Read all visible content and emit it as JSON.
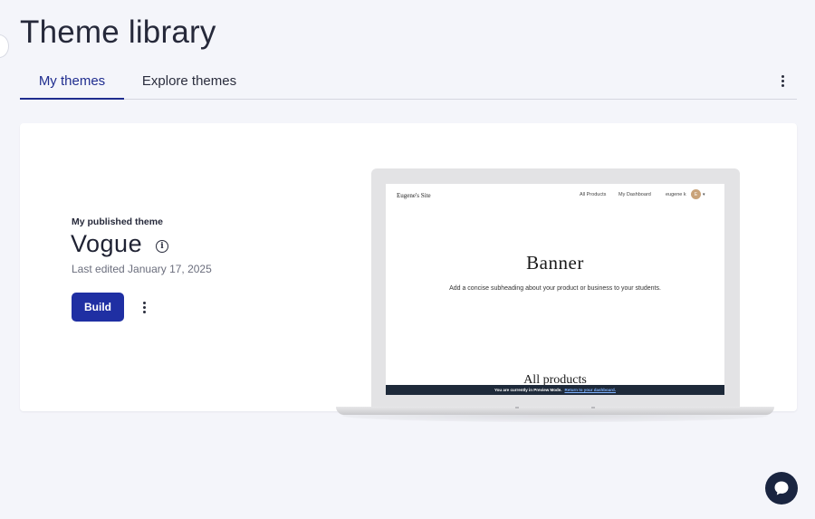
{
  "page": {
    "title": "Theme library"
  },
  "tabs": [
    {
      "label": "My themes",
      "active": true
    },
    {
      "label": "Explore themes",
      "active": false
    }
  ],
  "published": {
    "label": "My published theme",
    "theme_name": "Vogue",
    "last_edited": "Last edited January 17, 2025",
    "build_label": "Build"
  },
  "preview": {
    "site_name": "Eugene's Site",
    "nav": [
      "All Products",
      "My Dashboard"
    ],
    "user": "eugene k",
    "avatar_initial": "E",
    "banner_title": "Banner",
    "banner_subtitle": "Add a concise subheading about your product or business to your students.",
    "section_title": "All products",
    "preview_notice": "You are currently in Preview Mode.",
    "preview_link": "Return to your dashboard."
  },
  "colors": {
    "accent": "#1f2d8f",
    "button": "#1f2fa3",
    "background": "#f4f5fa",
    "chat": "#1a2540"
  },
  "icons": {
    "more": "kebab-vertical-icon",
    "info": "info-icon",
    "chat": "chat-bubble-icon"
  }
}
